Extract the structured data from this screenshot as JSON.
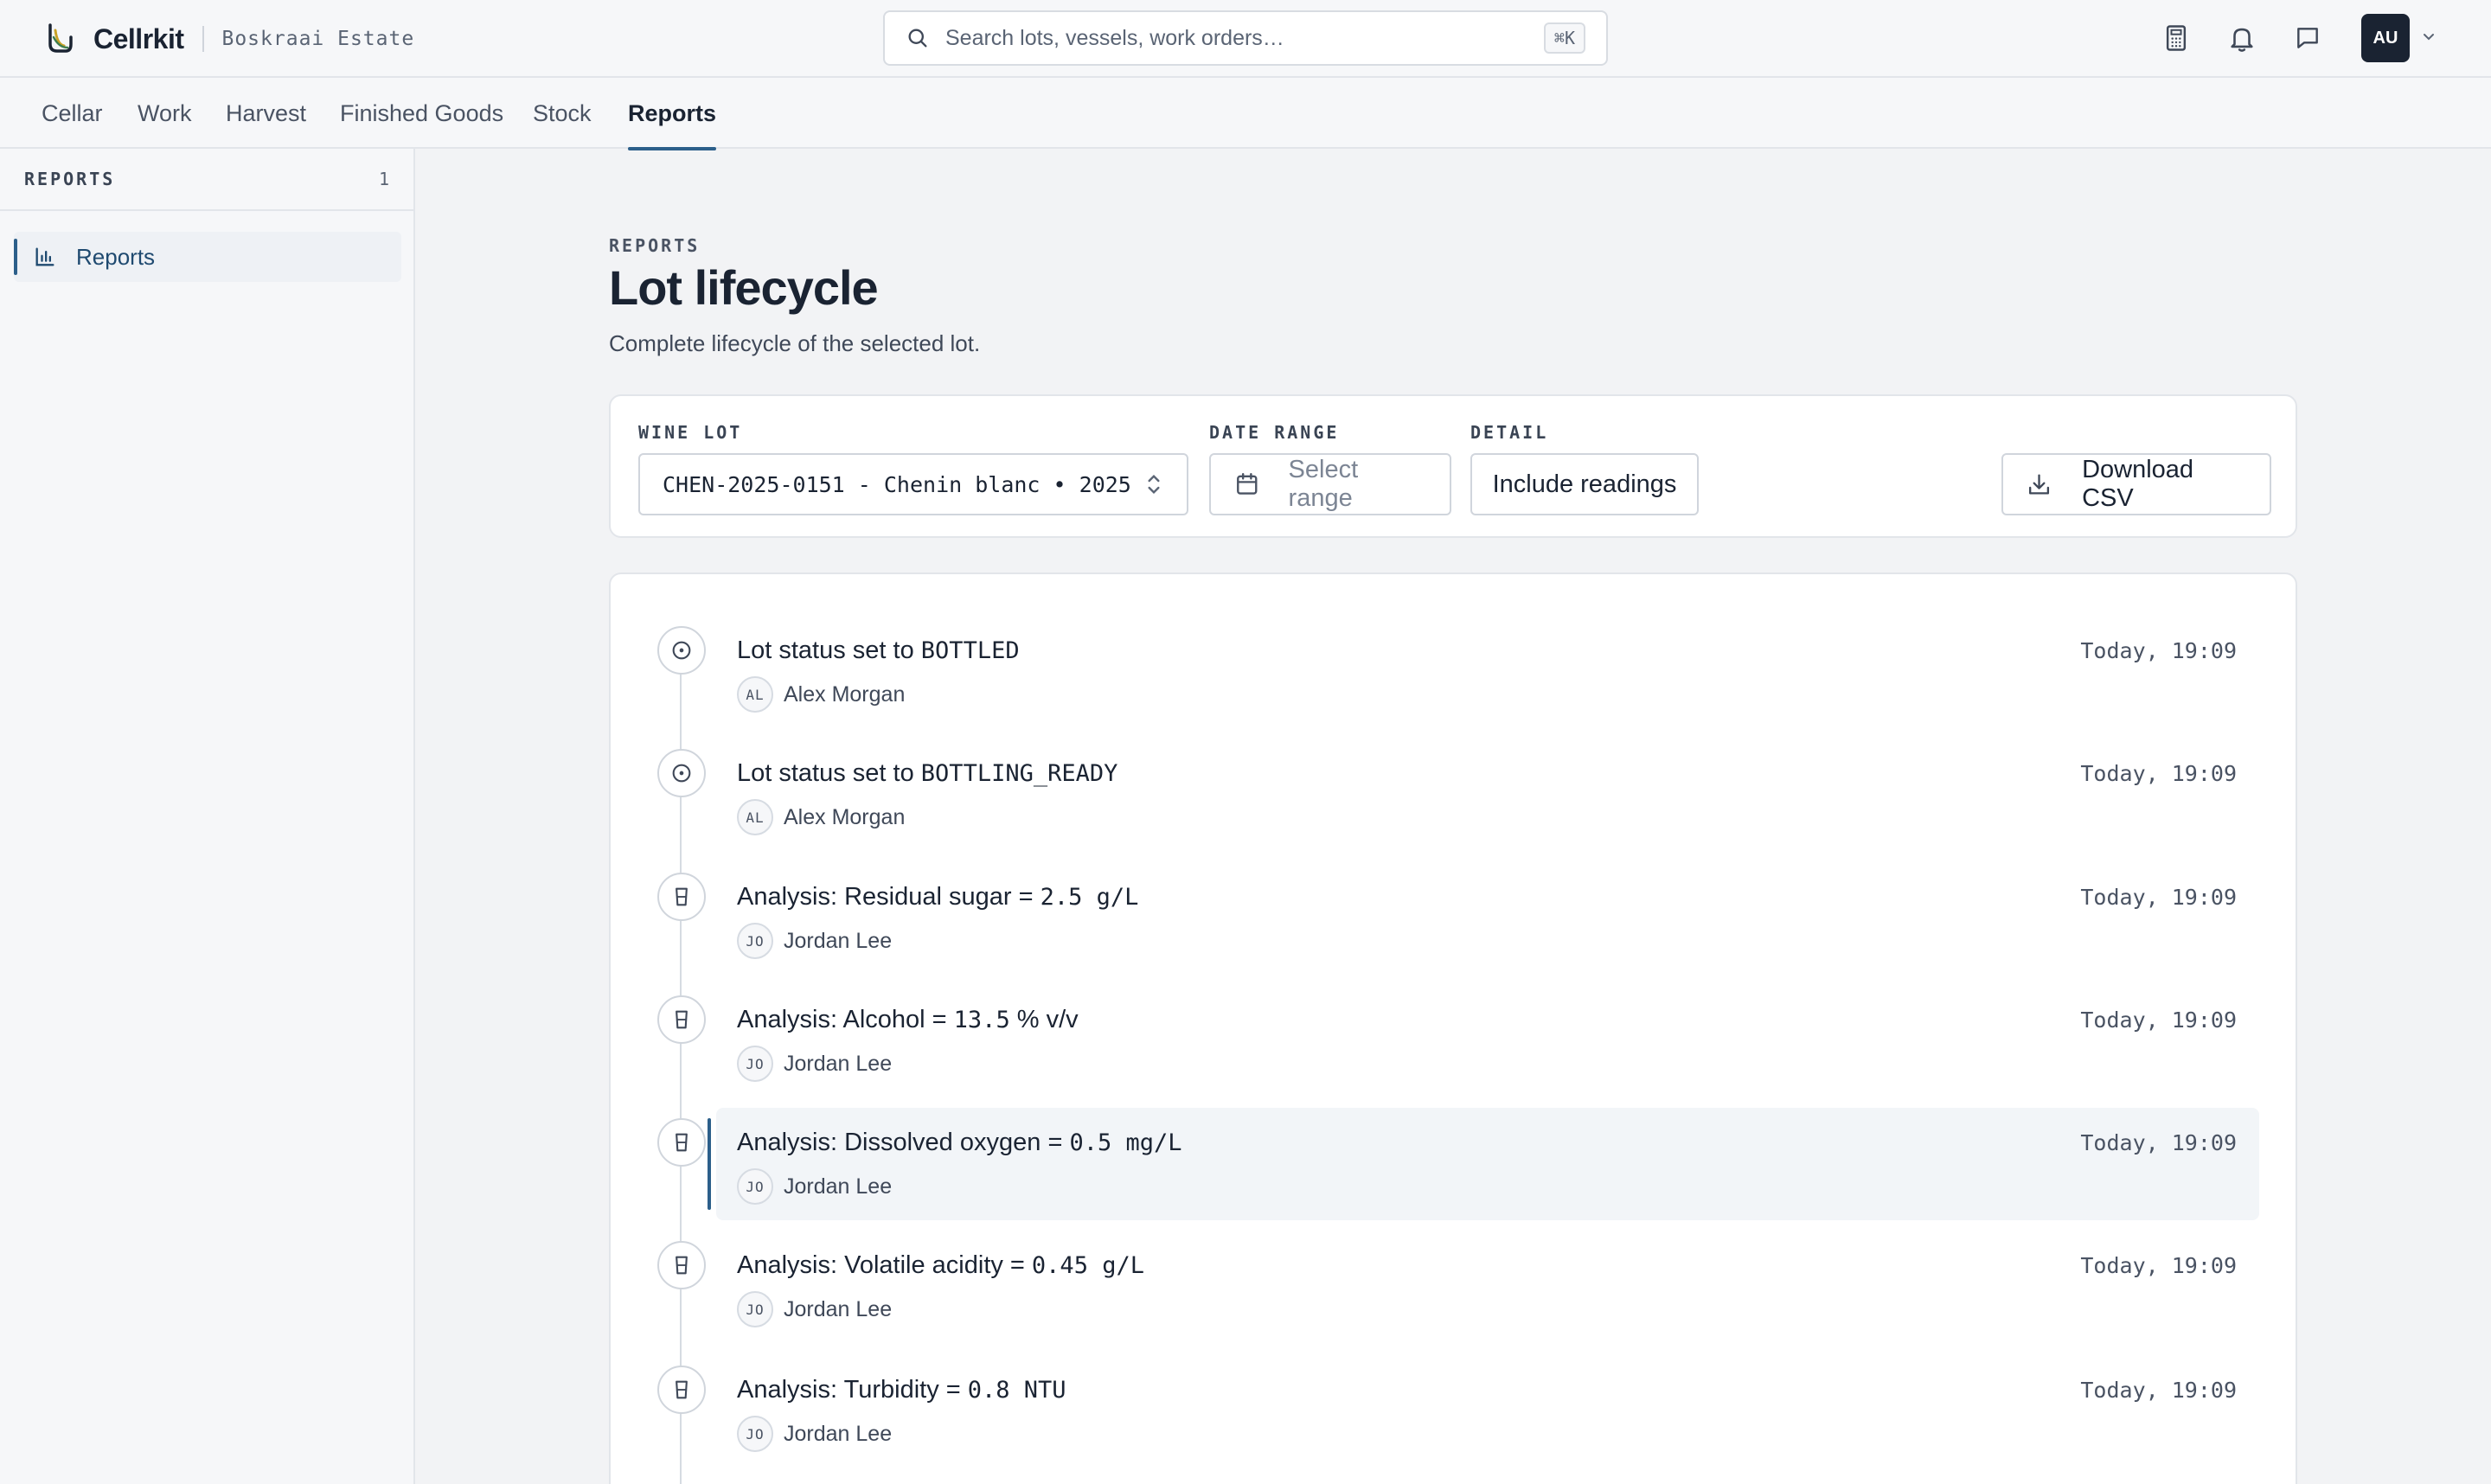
{
  "app": {
    "name": "Cellrkit",
    "estate": "Boskraai Estate"
  },
  "search": {
    "placeholder": "Search lots, vessels, work orders…",
    "shortcut": "⌘K"
  },
  "user": {
    "initials": "AU"
  },
  "nav": {
    "tabs": [
      {
        "label": "Cellar"
      },
      {
        "label": "Work"
      },
      {
        "label": "Harvest"
      },
      {
        "label": "Finished Goods"
      },
      {
        "label": "Stock"
      },
      {
        "label": "Reports",
        "active": true
      }
    ]
  },
  "sidebar": {
    "title": "REPORTS",
    "count": "1",
    "items": [
      {
        "label": "Reports",
        "icon": "bar-chart-icon",
        "active": true
      }
    ]
  },
  "page": {
    "eyebrow": "REPORTS",
    "title": "Lot lifecycle",
    "description": "Complete lifecycle of the selected lot."
  },
  "filters": {
    "wine_lot_label": "WINE LOT",
    "wine_lot_value": "CHEN-2025-0151 - Chenin blanc • 2025",
    "date_range_label": "DATE RANGE",
    "date_range_placeholder": "Select range",
    "detail_label": "DETAIL",
    "detail_button": "Include readings",
    "download_button": "Download CSV"
  },
  "events": [
    {
      "title": "Lot status set to ",
      "value": "BOTTLED",
      "initials": "AL",
      "user": "Alex Morgan",
      "time": "Today, 19:09",
      "icon": "status-icon"
    },
    {
      "title": "Lot status set to ",
      "value": "BOTTLING_READY",
      "initials": "AL",
      "user": "Alex Morgan",
      "time": "Today, 19:09",
      "icon": "status-icon"
    },
    {
      "title": "Analysis: Residual sugar = ",
      "value": "2.5 g/L",
      "initials": "JO",
      "user": "Jordan Lee",
      "time": "Today, 19:09",
      "icon": "beaker-icon"
    },
    {
      "title": "Analysis: Alcohol = ",
      "value": "13.5",
      "suffix": " % v/v",
      "initials": "JO",
      "user": "Jordan Lee",
      "time": "Today, 19:09",
      "icon": "beaker-icon"
    },
    {
      "title": "Analysis: Dissolved oxygen = ",
      "value": "0.5 mg/L",
      "initials": "JO",
      "user": "Jordan Lee",
      "time": "Today, 19:09",
      "icon": "beaker-icon",
      "highlight": true
    },
    {
      "title": "Analysis: Volatile acidity = ",
      "value": "0.45 g/L",
      "initials": "JO",
      "user": "Jordan Lee",
      "time": "Today, 19:09",
      "icon": "beaker-icon"
    },
    {
      "title": "Analysis: Turbidity = ",
      "value": "0.8 NTU",
      "initials": "JO",
      "user": "Jordan Lee",
      "time": "Today, 19:09",
      "icon": "beaker-icon"
    }
  ]
}
